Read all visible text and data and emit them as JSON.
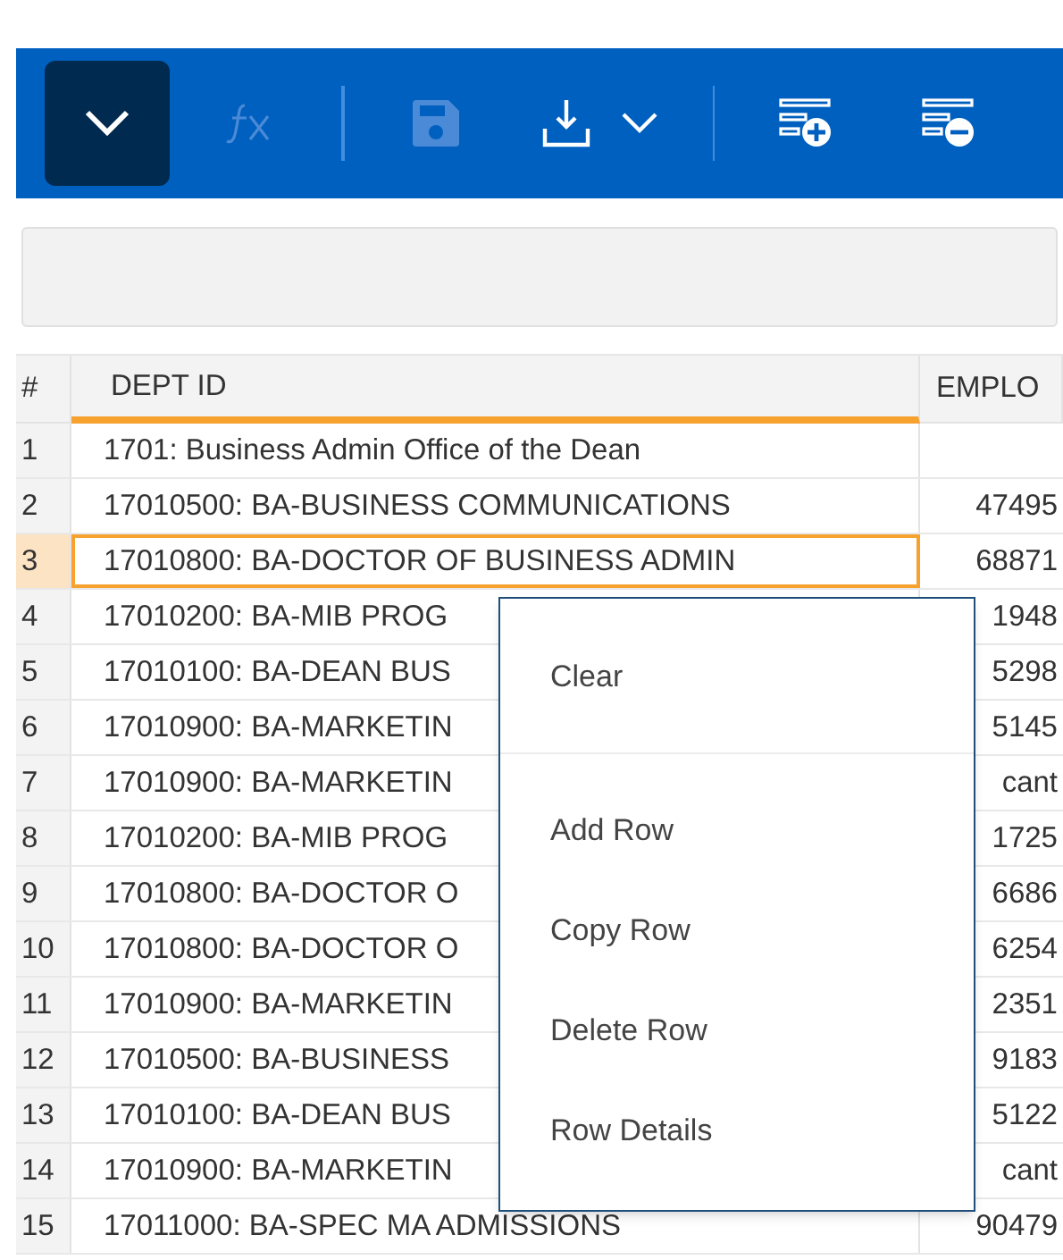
{
  "toolbar": {
    "items": [
      {
        "kind": "collapse",
        "selected": true,
        "disabled": false
      },
      {
        "kind": "formula",
        "selected": false,
        "disabled": true
      },
      {
        "kind": "divider"
      },
      {
        "kind": "save",
        "selected": false,
        "disabled": true
      },
      {
        "kind": "download",
        "selected": false,
        "disabled": false
      },
      {
        "kind": "divider"
      },
      {
        "kind": "add-row",
        "selected": false,
        "disabled": false
      },
      {
        "kind": "delete-row",
        "selected": false,
        "disabled": false
      }
    ]
  },
  "table": {
    "columns": [
      {
        "label": "#",
        "selected": false
      },
      {
        "label": "DEPT ID",
        "selected": true
      },
      {
        "label": "EMPLO",
        "selected": false
      }
    ],
    "rows": [
      {
        "num": "1",
        "dept": "1701: Business Admin Office of the Dean",
        "emp": "",
        "selected": false
      },
      {
        "num": "2",
        "dept": "17010500: BA-BUSINESS COMMUNICATIONS",
        "emp": "47495",
        "selected": false
      },
      {
        "num": "3",
        "dept": "17010800: BA-DOCTOR OF BUSINESS ADMIN",
        "emp": "68871",
        "selected": true
      },
      {
        "num": "4",
        "dept": "17010200: BA-MIB PROG",
        "emp": "1948",
        "selected": false
      },
      {
        "num": "5",
        "dept": "17010100: BA-DEAN BUS",
        "emp": "5298",
        "selected": false
      },
      {
        "num": "6",
        "dept": "17010900: BA-MARKETIN",
        "emp": "5145",
        "selected": false
      },
      {
        "num": "7",
        "dept": "17010900: BA-MARKETIN",
        "emp": "cant",
        "selected": false
      },
      {
        "num": "8",
        "dept": "17010200: BA-MIB PROG",
        "emp": "1725",
        "selected": false
      },
      {
        "num": "9",
        "dept": "17010800: BA-DOCTOR O",
        "emp": "6686",
        "selected": false
      },
      {
        "num": "10",
        "dept": "17010800: BA-DOCTOR O",
        "emp": "6254",
        "selected": false
      },
      {
        "num": "11",
        "dept": "17010900: BA-MARKETIN",
        "emp": "2351",
        "selected": false
      },
      {
        "num": "12",
        "dept": "17010500: BA-BUSINESS",
        "emp": "9183",
        "selected": false
      },
      {
        "num": "13",
        "dept": "17010100: BA-DEAN BUS",
        "emp": "5122",
        "selected": false
      },
      {
        "num": "14",
        "dept": "17010900: BA-MARKETIN",
        "emp": "cant",
        "selected": false
      },
      {
        "num": "15",
        "dept": "17011000: BA-SPEC MA ADMISSIONS",
        "emp": "90479",
        "selected": false
      }
    ]
  },
  "context_menu": {
    "groups": [
      [
        "Clear"
      ],
      [
        "Add Row",
        "Copy Row",
        "Delete Row",
        "Row Details"
      ]
    ]
  }
}
